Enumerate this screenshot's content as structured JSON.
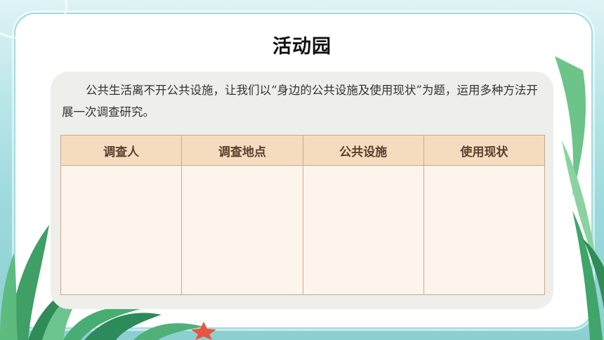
{
  "page": {
    "title": "活动园",
    "intro": "公共生活离不开公共设施，让我们以“身边的公共设施及使用现状”为题，运用多种方法开展一次调查研究。"
  },
  "table": {
    "headers": [
      "调查人",
      "调查地点",
      "公共设施",
      "使用现状"
    ],
    "rows": [
      [
        "",
        "",
        "",
        ""
      ]
    ]
  },
  "colors": {
    "header_fill": "#f5dcbf",
    "cell_fill": "#fdf5ec",
    "panel_fill": "#eeeeea",
    "frame_border": "#9fdbe0",
    "leaf_green": "#3fa56a",
    "starfish": "#e8553d"
  },
  "decor": {
    "icons": [
      "palm-leaf-icon",
      "fern-icon",
      "starfish-icon",
      "seaweed-icon"
    ]
  }
}
